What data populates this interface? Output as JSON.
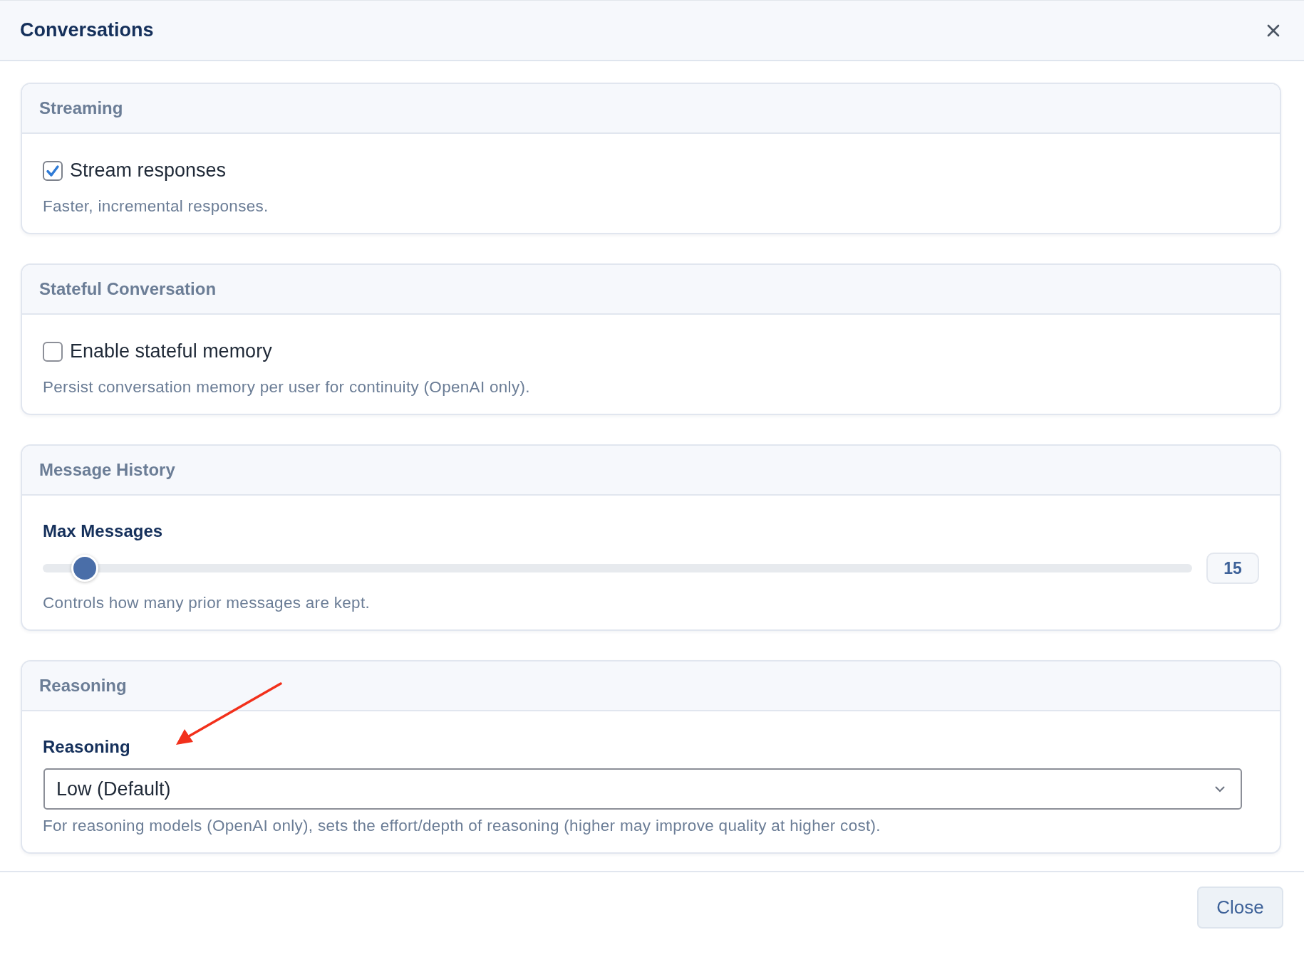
{
  "dialog": {
    "title": "Conversations"
  },
  "sections": [
    {
      "title": "Streaming",
      "kind": "checkbox",
      "label": "Stream responses",
      "checked": true,
      "help": "Faster, incremental responses."
    },
    {
      "title": "Stateful Conversation",
      "kind": "checkbox",
      "label": "Enable stateful memory",
      "checked": false,
      "help": "Persist conversation memory per user for continuity (OpenAI only)."
    },
    {
      "title": "Message History",
      "kind": "slider",
      "label": "Max Messages",
      "level": 0.025,
      "reading": "15",
      "help": "Controls how many prior messages are kept."
    },
    {
      "title": "Reasoning",
      "kind": "select",
      "label": "Reasoning",
      "value": "Low (Default)",
      "help": "For reasoning models (OpenAI only), sets the effort/depth of reasoning (higher may improve quality at higher cost)."
    }
  ],
  "footer": {
    "button": "Close"
  }
}
